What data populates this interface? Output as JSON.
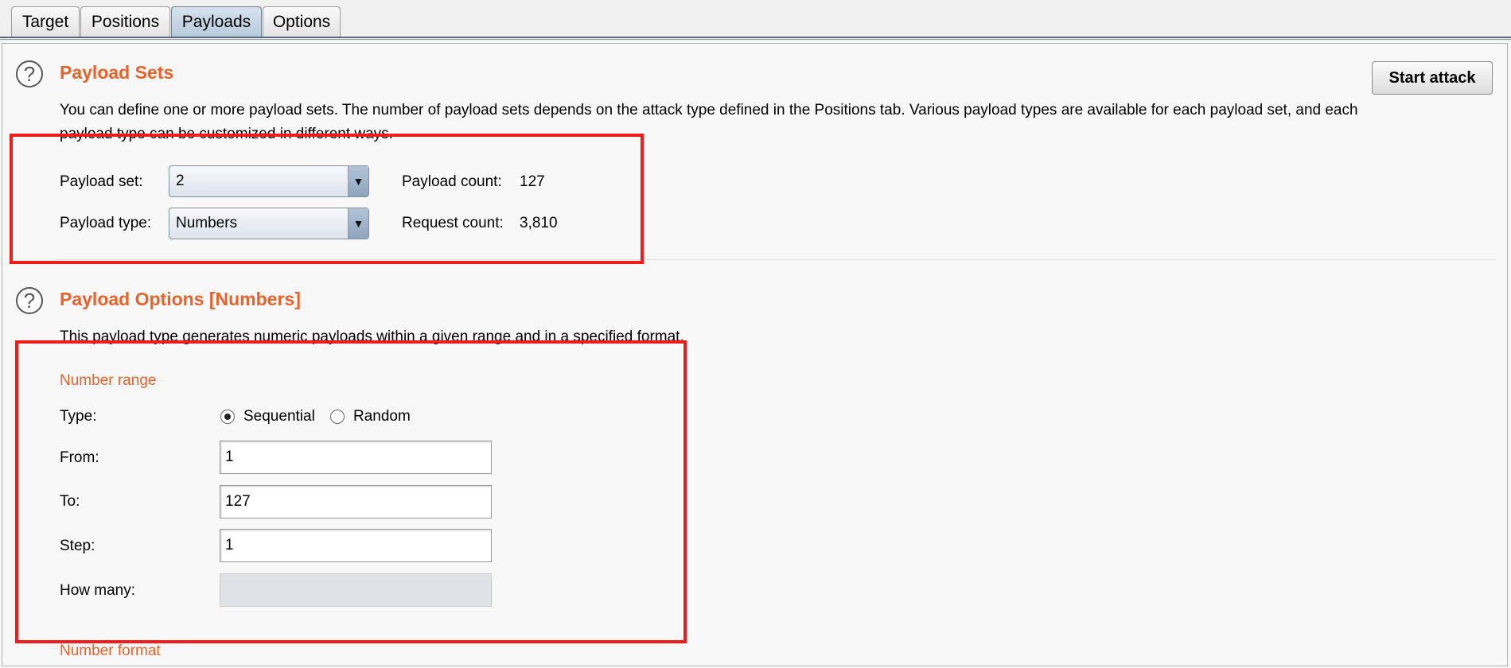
{
  "tabs": [
    {
      "label": "Target",
      "active": false
    },
    {
      "label": "Positions",
      "active": false
    },
    {
      "label": "Payloads",
      "active": true
    },
    {
      "label": "Options",
      "active": false
    }
  ],
  "payload_sets": {
    "title": "Payload Sets",
    "description": "You can define one or more payload sets. The number of payload sets depends on the attack type defined in the Positions tab. Various payload types are available for each payload set, and each payload type can be customized in different ways.",
    "payload_set_label": "Payload set:",
    "payload_set_value": "2",
    "payload_type_label": "Payload type:",
    "payload_type_value": "Numbers",
    "payload_count_label": "Payload count:",
    "payload_count_value": "127",
    "request_count_label": "Request count:",
    "request_count_value": "3,810",
    "start_attack_label": "Start attack"
  },
  "payload_options": {
    "title": "Payload Options [Numbers]",
    "description": "This payload type generates numeric payloads within a given range and in a specified format.",
    "number_range_label": "Number range",
    "type_label": "Type:",
    "sequential_label": "Sequential",
    "random_label": "Random",
    "selected_type": "Sequential",
    "from_label": "From:",
    "from_value": "1",
    "to_label": "To:",
    "to_value": "127",
    "step_label": "Step:",
    "step_value": "1",
    "how_many_label": "How many:",
    "how_many_value": "",
    "number_format_label": "Number format"
  },
  "icons": {
    "help": "help-icon",
    "dropdown": "chevron-down-icon"
  },
  "colors": {
    "heading": "#e8622c",
    "annotation": "#ee1c1c",
    "active_tab": "#c4d4e4"
  }
}
